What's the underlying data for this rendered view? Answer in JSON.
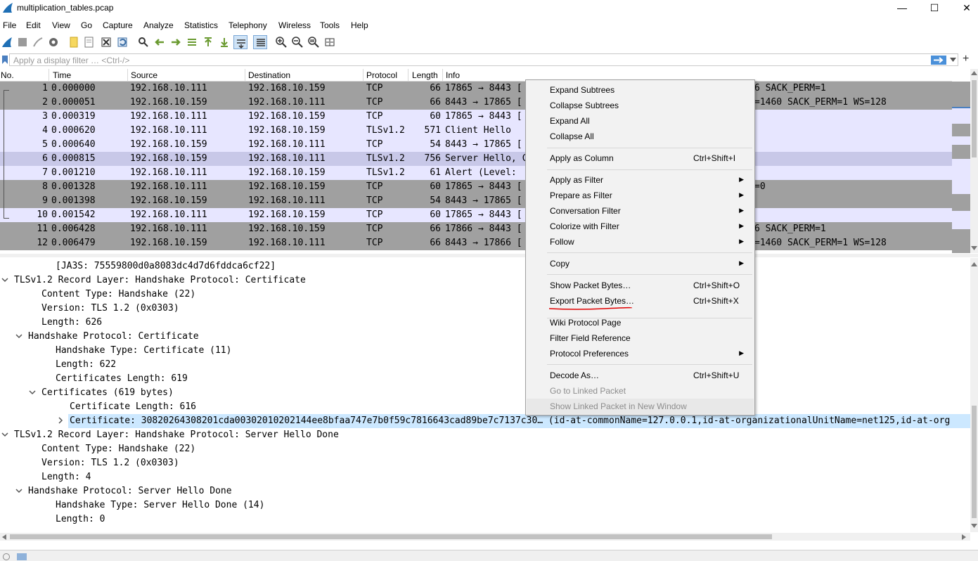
{
  "window": {
    "title": "multiplication_tables.pcap",
    "minimize": "—",
    "maximize": "☐",
    "close": "✕"
  },
  "menu": [
    "File",
    "Edit",
    "View",
    "Go",
    "Capture",
    "Analyze",
    "Statistics",
    "Telephony",
    "Wireless",
    "Tools",
    "Help"
  ],
  "filter": {
    "placeholder": "Apply a display filter … <Ctrl-/>",
    "add_label": "+"
  },
  "packet_list": {
    "columns": [
      "No.",
      "Time",
      "Source",
      "Destination",
      "Protocol",
      "Length",
      "Info"
    ],
    "rows": [
      {
        "no": "1",
        "time": "0.000000",
        "src": "192.168.10.111",
        "dst": "192.168.10.159",
        "proto": "TCP",
        "len": "66",
        "info": "17865 → 8443 [",
        "info_tail": "6 SACK_PERM=1"
      },
      {
        "no": "2",
        "time": "0.000051",
        "src": "192.168.10.159",
        "dst": "192.168.10.111",
        "proto": "TCP",
        "len": "66",
        "info": "8443 → 17865 [",
        "info_tail": "=1460 SACK_PERM=1 WS=128"
      },
      {
        "no": "3",
        "time": "0.000319",
        "src": "192.168.10.111",
        "dst": "192.168.10.159",
        "proto": "TCP",
        "len": "60",
        "info": "17865 → 8443 [",
        "info_tail": ""
      },
      {
        "no": "4",
        "time": "0.000620",
        "src": "192.168.10.111",
        "dst": "192.168.10.159",
        "proto": "TLSv1.2",
        "len": "571",
        "info": "Client Hello",
        "info_tail": ""
      },
      {
        "no": "5",
        "time": "0.000640",
        "src": "192.168.10.159",
        "dst": "192.168.10.111",
        "proto": "TCP",
        "len": "54",
        "info": "8443 → 17865 [",
        "info_tail": ""
      },
      {
        "no": "6",
        "time": "0.000815",
        "src": "192.168.10.159",
        "dst": "192.168.10.111",
        "proto": "TLSv1.2",
        "len": "756",
        "info": "Server Hello, C",
        "info_tail": ""
      },
      {
        "no": "7",
        "time": "0.001210",
        "src": "192.168.10.111",
        "dst": "192.168.10.159",
        "proto": "TLSv1.2",
        "len": "61",
        "info": "Alert (Level: ",
        "info_tail": ""
      },
      {
        "no": "8",
        "time": "0.001328",
        "src": "192.168.10.111",
        "dst": "192.168.10.159",
        "proto": "TCP",
        "len": "60",
        "info": "17865 → 8443 [",
        "info_tail": "=0"
      },
      {
        "no": "9",
        "time": "0.001398",
        "src": "192.168.10.159",
        "dst": "192.168.10.111",
        "proto": "TCP",
        "len": "54",
        "info": "8443 → 17865 [",
        "info_tail": ""
      },
      {
        "no": "10",
        "time": "0.001542",
        "src": "192.168.10.111",
        "dst": "192.168.10.159",
        "proto": "TCP",
        "len": "60",
        "info": "17865 → 8443 [",
        "info_tail": ""
      },
      {
        "no": "11",
        "time": "0.006428",
        "src": "192.168.10.111",
        "dst": "192.168.10.159",
        "proto": "TCP",
        "len": "66",
        "info": "17866 → 8443 [",
        "info_tail": "6 SACK_PERM=1"
      },
      {
        "no": "12",
        "time": "0.006479",
        "src": "192.168.10.159",
        "dst": "192.168.10.111",
        "proto": "TCP",
        "len": "66",
        "info": "8443 → 17866 [",
        "info_tail": "=1460 SACK_PERM=1 WS=128"
      }
    ]
  },
  "details": [
    {
      "text": "[JA3S: 75559800d0a8083dc4d7d6fddca6cf22]",
      "arrow": ""
    },
    {
      "text": "TLSv1.2 Record Layer: Handshake Protocol: Certificate",
      "arrow": "down"
    },
    {
      "text": "Content Type: Handshake (22)",
      "arrow": ""
    },
    {
      "text": "Version: TLS 1.2 (0x0303)",
      "arrow": ""
    },
    {
      "text": "Length: 626",
      "arrow": ""
    },
    {
      "text": "Handshake Protocol: Certificate",
      "arrow": "down"
    },
    {
      "text": "Handshake Type: Certificate (11)",
      "arrow": ""
    },
    {
      "text": "Length: 622",
      "arrow": ""
    },
    {
      "text": "Certificates Length: 619",
      "arrow": ""
    },
    {
      "text": "Certificates (619 bytes)",
      "arrow": "down"
    },
    {
      "text": "Certificate Length: 616",
      "arrow": ""
    },
    {
      "text": "Certificate: 30820264308201cda00302010202144ee8bfaa747e7b0f59c7816643cad89be7c7137c30… (id-at-commonName=127.0.0.1,id-at-organizationalUnitName=net125,id-at-org",
      "arrow": "right"
    },
    {
      "text": "TLSv1.2 Record Layer: Handshake Protocol: Server Hello Done",
      "arrow": "down"
    },
    {
      "text": "Content Type: Handshake (22)",
      "arrow": ""
    },
    {
      "text": "Version: TLS 1.2 (0x0303)",
      "arrow": ""
    },
    {
      "text": "Length: 4",
      "arrow": ""
    },
    {
      "text": "Handshake Protocol: Server Hello Done",
      "arrow": "down"
    },
    {
      "text": "Handshake Type: Server Hello Done (14)",
      "arrow": ""
    },
    {
      "text": "Length: 0",
      "arrow": ""
    }
  ],
  "context_menu": [
    {
      "label": "Expand Subtrees",
      "shortcut": "",
      "submenu": false,
      "disabled": false
    },
    {
      "label": "Collapse Subtrees",
      "shortcut": "",
      "submenu": false,
      "disabled": false
    },
    {
      "label": "Expand All",
      "shortcut": "",
      "submenu": false,
      "disabled": false
    },
    {
      "label": "Collapse All",
      "shortcut": "",
      "submenu": false,
      "disabled": false
    },
    {
      "label": "Apply as Column",
      "shortcut": "Ctrl+Shift+I",
      "submenu": false,
      "disabled": false
    },
    {
      "label": "Apply as Filter",
      "shortcut": "",
      "submenu": true,
      "disabled": false
    },
    {
      "label": "Prepare as Filter",
      "shortcut": "",
      "submenu": true,
      "disabled": false
    },
    {
      "label": "Conversation Filter",
      "shortcut": "",
      "submenu": true,
      "disabled": false
    },
    {
      "label": "Colorize with Filter",
      "shortcut": "",
      "submenu": true,
      "disabled": false
    },
    {
      "label": "Follow",
      "shortcut": "",
      "submenu": true,
      "disabled": false
    },
    {
      "label": "Copy",
      "shortcut": "",
      "submenu": true,
      "disabled": false
    },
    {
      "label": "Show Packet Bytes…",
      "shortcut": "Ctrl+Shift+O",
      "submenu": false,
      "disabled": false
    },
    {
      "label": "Export Packet Bytes…",
      "shortcut": "Ctrl+Shift+X",
      "submenu": false,
      "disabled": false
    },
    {
      "label": "Wiki Protocol Page",
      "shortcut": "",
      "submenu": false,
      "disabled": false
    },
    {
      "label": "Filter Field Reference",
      "shortcut": "",
      "submenu": false,
      "disabled": false
    },
    {
      "label": "Protocol Preferences",
      "shortcut": "",
      "submenu": true,
      "disabled": false
    },
    {
      "label": "Decode As…",
      "shortcut": "Ctrl+Shift+U",
      "submenu": false,
      "disabled": false
    },
    {
      "label": "Go to Linked Packet",
      "shortcut": "",
      "submenu": false,
      "disabled": true
    },
    {
      "label": "Show Linked Packet in New Window",
      "shortcut": "",
      "submenu": false,
      "disabled": true
    }
  ],
  "colors": {
    "tcp_gray": "#a0a0a0",
    "tcp_light": "#e7e6ff",
    "tls_selected": "#c8c8e8",
    "detail_selected": "#cce8ff",
    "annotation_underline": "#e00000"
  }
}
